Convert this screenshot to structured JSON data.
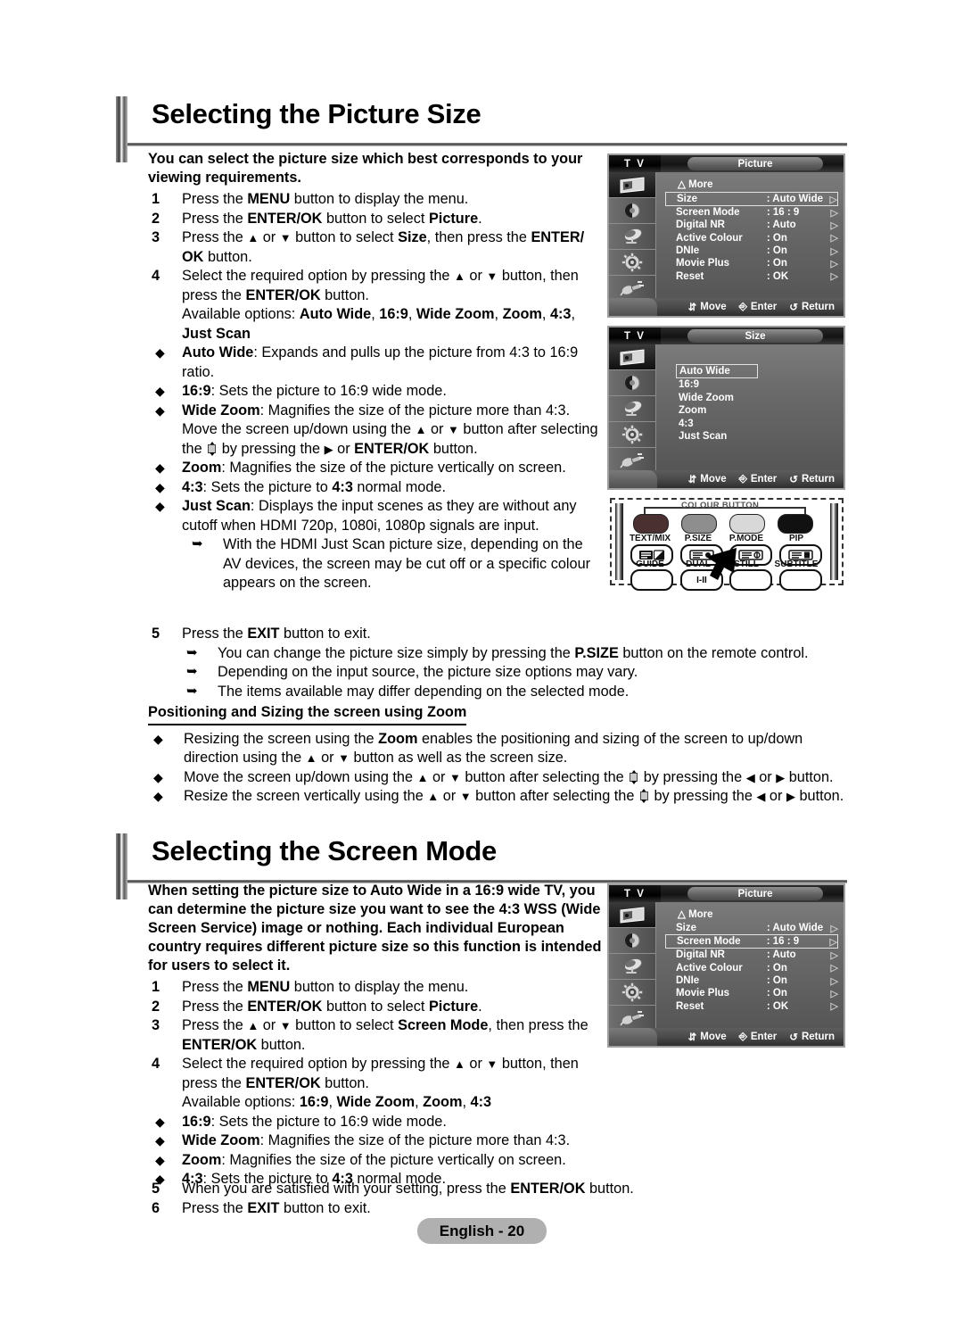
{
  "page": {
    "footer_label": "English - 20"
  },
  "section1": {
    "title": "Selecting the Picture Size",
    "intro": "You can select the picture size which best corresponds to your viewing requirements.",
    "steps": [
      {
        "num": "1",
        "html": "Press the <b>MENU</b> button to display the menu."
      },
      {
        "num": "2",
        "html": "Press the <b>ENTER/OK</b> button to select <b>Picture</b>."
      },
      {
        "num": "3",
        "html": "Press the <span class=\"ar\">▲</span> or <span class=\"ar\">▼</span> button to select <b>Size</b>, then press the <b>ENTER/ OK</b> button."
      },
      {
        "num": "4",
        "html": "Select the required option by pressing the <span class=\"ar\">▲</span> or <span class=\"ar\">▼</span> button, then press the <b>ENTER/OK</b> button."
      }
    ],
    "available_options": "Available options: <b>Auto Wide</b>, <b>16:9</b>, <b>Wide Zoom</b>, <b>Zoom</b>, <b>4:3</b>, <b>Just Scan</b>",
    "bullets": [
      "<b>Auto Wide</b>: Expands and pulls up the picture from 4:3 to 16:9 ratio.",
      "<b>16:9</b>: Sets the picture to 16:9 wide mode.",
      "<b>Wide Zoom</b>: Magnifies the size of the picture more than 4:3. Move the screen up/down using the <span class=\"ar\">▲</span> or <span class=\"ar\">▼</span> button after selecting the <span class=\"gly\"><span class=\"tri-u\"></span><span class=\"bx\"></span><span class=\"tri-d\"></span></span> by pressing the <span class=\"ar\">▶</span> or <b>ENTER/OK</b> button.",
      "<b>Zoom</b>: Magnifies the size of the picture vertically on screen.",
      "<b>4:3</b>: Sets the picture to <b>4:3</b> normal mode.",
      "<b>Just Scan</b>: Displays the input scenes as they are without any cutoff when HDMI 720p, 1080i, 1080p signals are input."
    ],
    "just_scan_note": "With the HDMI Just Scan picture size, depending on the AV devices, the screen may be cut off or a specific colour appears on the screen.",
    "step5": {
      "num": "5",
      "html": "Press the <b>EXIT</b> button to exit."
    },
    "notes": [
      "You can change the picture size simply by pressing the <b>P.SIZE</b> button on the remote control.",
      "Depending on the input source, the picture size options may vary.",
      "The items available may differ depending on the selected mode."
    ],
    "subhead": "Positioning and Sizing the screen using Zoom",
    "zoom_bullets": [
      "Resizing the screen using the <b>Zoom</b> enables the positioning and sizing of the screen to up/down direction using the <span class=\"ar\">▲</span> or <span class=\"ar\">▼</span> button as well as the screen size.",
      "Move the screen up/down using the <span class=\"ar\">▲</span> or <span class=\"ar\">▼</span> button after selecting the <span class=\"gly\"><span class=\"tri-u\"></span><span class=\"bx\"></span><span class=\"tri-d\"></span></span> by pressing the <span class=\"ar\">◀</span> or <span class=\"ar\">▶</span> button.",
      "Resize the screen vertically using the <span class=\"ar\">▲</span> or <span class=\"ar\">▼</span> button after selecting the <span class=\"gly\"><span class=\"tri-u\"></span><span class=\"bx\"></span><span class=\"tri-d\"></span></span> by pressing the <span class=\"ar\">◀</span> or <span class=\"ar\">▶</span> button."
    ]
  },
  "section2": {
    "title": "Selecting the Screen Mode",
    "intro": "When setting the picture size to Auto Wide in a 16:9 wide TV, you can determine the picture size you want to see the 4:3 WSS (Wide Screen Service) image or nothing. Each individual European country requires different picture size so this function is intended for users to select it.",
    "steps": [
      {
        "num": "1",
        "html": "Press the <b>MENU</b> button to display the menu."
      },
      {
        "num": "2",
        "html": "Press the <b>ENTER/OK</b> button to select <b>Picture</b>."
      },
      {
        "num": "3",
        "html": "Press the <span class=\"ar\">▲</span> or <span class=\"ar\">▼</span> button to select <b>Screen Mode</b>, then press the <b>ENTER/OK</b> button."
      },
      {
        "num": "4",
        "html": "Select the required option by pressing the <span class=\"ar\">▲</span> or <span class=\"ar\">▼</span> button, then press the <b>ENTER/OK</b> button."
      }
    ],
    "available_options": "Available options: <b>16:9</b>, <b>Wide Zoom</b>, <b>Zoom</b>, <b>4:3</b>",
    "bullets": [
      "<b>16:9</b>: Sets the picture to 16:9 wide mode.",
      "<b>Wide Zoom</b>: Magnifies the size of the picture more than 4:3.",
      "<b>Zoom</b>: Magnifies the size of the picture vertically on screen.",
      "<b>4:3</b>: Sets the picture to <b>4:3</b> normal mode."
    ],
    "step5": {
      "num": "5",
      "html": "When you are satisfied with your setting, press the <b>ENTER/OK</b> button."
    },
    "step6": {
      "num": "6",
      "html": "Press the <b>EXIT</b> button to exit."
    }
  },
  "osd_picture_1": {
    "tv_label": "T V",
    "title": "Picture",
    "more_label": "More",
    "rows": [
      {
        "label": "Size",
        "value": ": Auto Wide",
        "selected": true
      },
      {
        "label": "Screen Mode",
        "value": ": 16 : 9",
        "selected": false
      },
      {
        "label": "Digital NR",
        "value": ": Auto",
        "selected": false
      },
      {
        "label": "Active Colour",
        "value": ": On",
        "selected": false
      },
      {
        "label": "DNIe",
        "value": ": On",
        "selected": false
      },
      {
        "label": "Movie Plus",
        "value": ": On",
        "selected": false
      },
      {
        "label": "Reset",
        "value": ": OK",
        "selected": false
      }
    ],
    "footer": {
      "move": "Move",
      "enter": "Enter",
      "return": "Return"
    },
    "side_icons": [
      "picture-icon",
      "sound-icon",
      "channel-icon",
      "setup-icon",
      "input-icon"
    ]
  },
  "osd_size": {
    "tv_label": "T V",
    "title": "Size",
    "items": [
      {
        "label": "Auto Wide",
        "selected": true
      },
      {
        "label": "16:9",
        "selected": false
      },
      {
        "label": "Wide Zoom",
        "selected": false
      },
      {
        "label": "Zoom",
        "selected": false
      },
      {
        "label": "4:3",
        "selected": false
      },
      {
        "label": "Just Scan",
        "selected": false
      }
    ],
    "footer": {
      "move": "Move",
      "enter": "Enter",
      "return": "Return"
    }
  },
  "osd_picture_2": {
    "tv_label": "T V",
    "title": "Picture",
    "more_label": "More",
    "rows": [
      {
        "label": "Size",
        "value": ": Auto Wide",
        "selected": false
      },
      {
        "label": "Screen Mode",
        "value": ": 16 : 9",
        "selected": true
      },
      {
        "label": "Digital NR",
        "value": ": Auto",
        "selected": false
      },
      {
        "label": "Active Colour",
        "value": ": On",
        "selected": false
      },
      {
        "label": "DNIe",
        "value": ": On",
        "selected": false
      },
      {
        "label": "Movie Plus",
        "value": ": On",
        "selected": false
      },
      {
        "label": "Reset",
        "value": ": OK",
        "selected": false
      }
    ],
    "footer": {
      "move": "Move",
      "enter": "Enter",
      "return": "Return"
    }
  },
  "remote": {
    "colour_button_label": "COLOUR BUTTON",
    "colour_buttons": [
      {
        "name": "red-button",
        "color": "#4a3030"
      },
      {
        "name": "green-button",
        "color": "#8e8e8e"
      },
      {
        "name": "yellow-button",
        "color": "#d8d8d8"
      },
      {
        "name": "blue-button",
        "color": "#111111"
      }
    ],
    "row1_labels": [
      "TEXT/MIX",
      "P.SIZE",
      "P.MODE",
      "PIP"
    ],
    "row2_labels": [
      "GUIDE",
      "DUAL",
      "STILL",
      "SUBTITLE"
    ],
    "dual_text": "I-II"
  }
}
